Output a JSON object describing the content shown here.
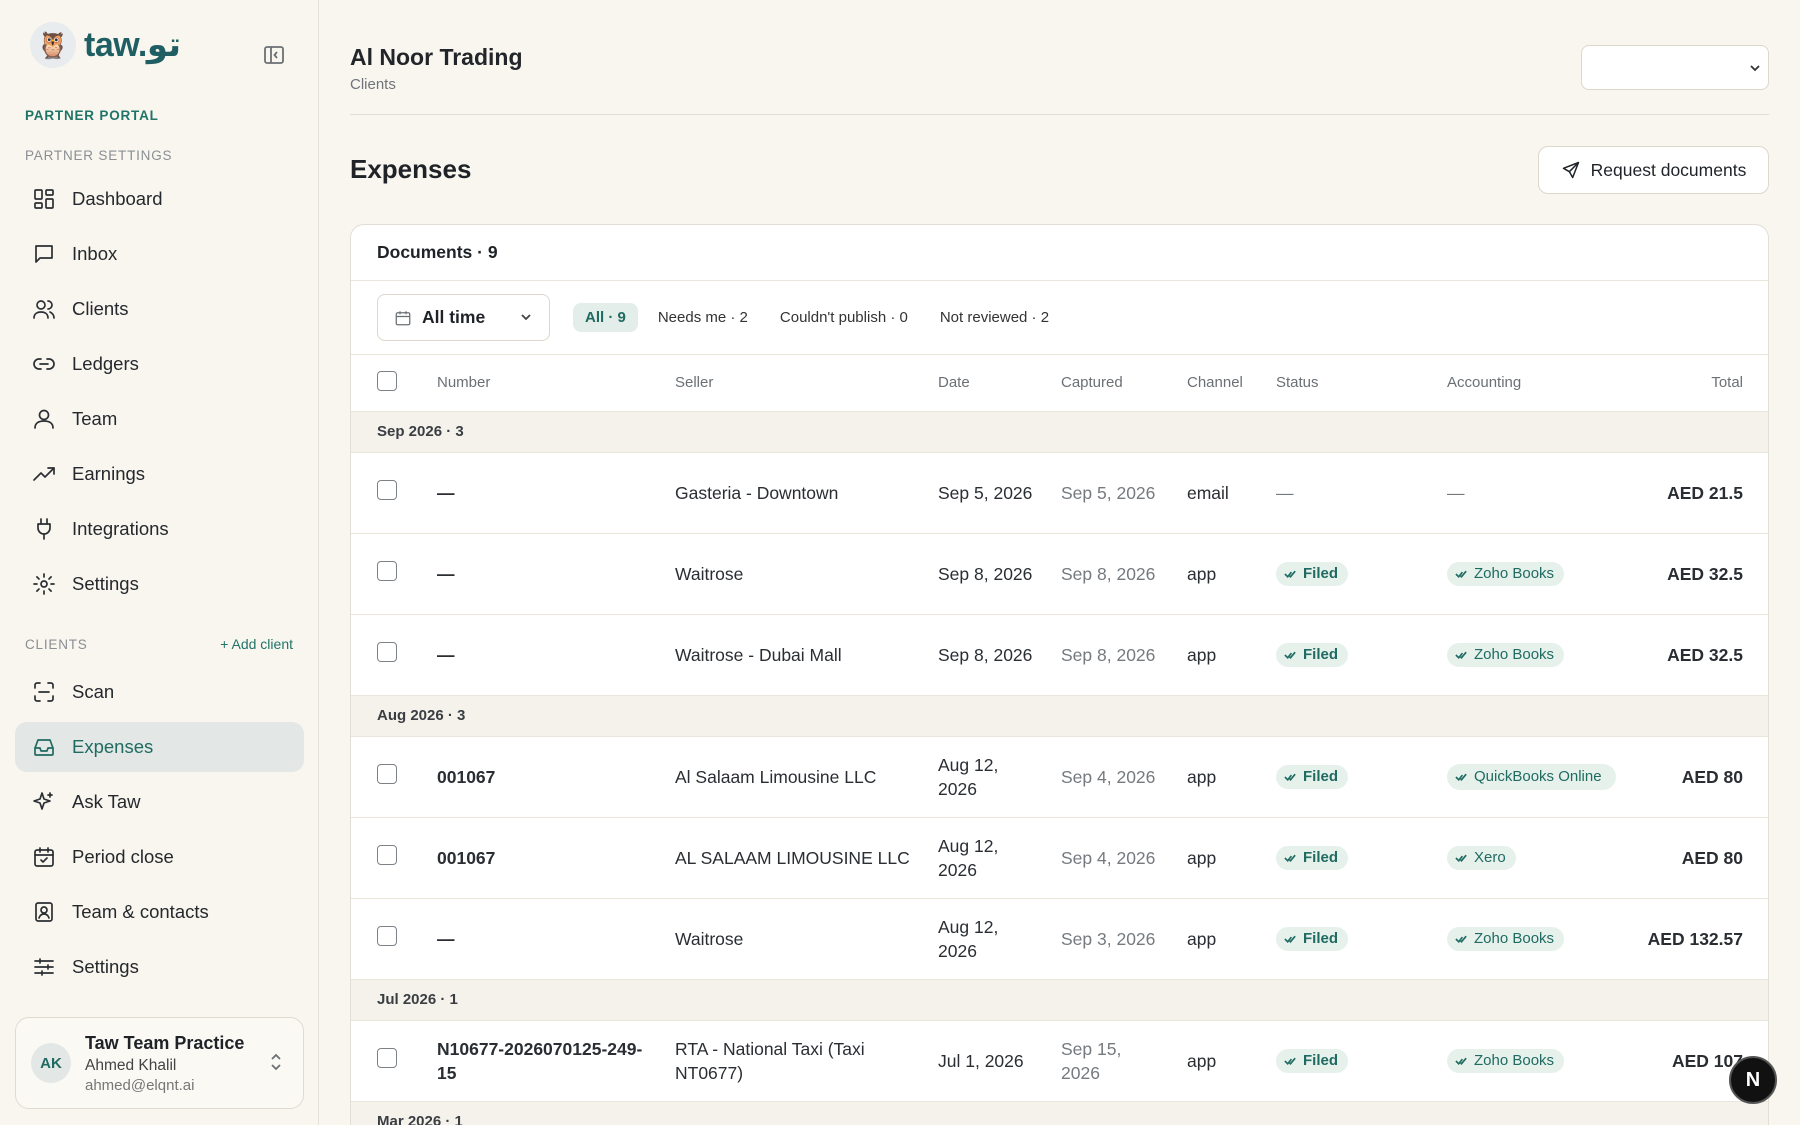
{
  "brand": {
    "name": "taw.",
    "arabic": "تو"
  },
  "sidebar": {
    "portal_label": "PARTNER PORTAL",
    "settings_label": "PARTNER SETTINGS",
    "partner_items": [
      {
        "label": "Dashboard",
        "icon": "dashboard-icon"
      },
      {
        "label": "Inbox",
        "icon": "chat-icon"
      },
      {
        "label": "Clients",
        "icon": "users-icon"
      },
      {
        "label": "Ledgers",
        "icon": "link-icon"
      },
      {
        "label": "Team",
        "icon": "user-icon"
      },
      {
        "label": "Earnings",
        "icon": "trend-icon"
      },
      {
        "label": "Integrations",
        "icon": "plug-icon"
      },
      {
        "label": "Settings",
        "icon": "gear-icon"
      }
    ],
    "clients_label": "CLIENTS",
    "add_client": "+ Add client",
    "client_items": [
      {
        "label": "Scan",
        "icon": "scan-icon"
      },
      {
        "label": "Expenses",
        "icon": "inbox-tray-icon",
        "active": true
      },
      {
        "label": "Ask Taw",
        "icon": "sparkle-icon"
      },
      {
        "label": "Period close",
        "icon": "calendar-check-icon"
      },
      {
        "label": "Team & contacts",
        "icon": "contact-icon"
      },
      {
        "label": "Settings",
        "icon": "sliders-icon"
      }
    ],
    "user": {
      "initials": "AK",
      "practice": "Taw Team Practice",
      "name": "Ahmed Khalil",
      "email": "ahmed@elqnt.ai"
    }
  },
  "header": {
    "title": "Al Noor Trading",
    "subtitle": "Clients"
  },
  "page": {
    "title": "Expenses",
    "request_button": "Request documents"
  },
  "documents": {
    "heading": "Documents · 9",
    "date_filter": "All time",
    "chips": [
      "All · 9",
      "Needs me · 2",
      "Couldn't publish · 0",
      "Not reviewed · 2"
    ],
    "columns": [
      "Number",
      "Seller",
      "Date",
      "Captured",
      "Channel",
      "Status",
      "Accounting",
      "Total"
    ],
    "groups": [
      {
        "label": "Sep 2026 · 3",
        "rows": [
          {
            "number": "—",
            "seller": "Gasteria - Downtown",
            "date": "Sep 5, 2026",
            "captured": "Sep 5, 2026",
            "channel": "email",
            "status": "—",
            "accounting": "—",
            "total": "AED 21.5"
          },
          {
            "number": "—",
            "seller": "Waitrose",
            "date": "Sep 8, 2026",
            "captured": "Sep 8, 2026",
            "channel": "app",
            "status": "Filed",
            "accounting": "Zoho Books",
            "total": "AED 32.5"
          },
          {
            "number": "—",
            "seller": "Waitrose - Dubai Mall",
            "date": "Sep 8, 2026",
            "captured": "Sep 8, 2026",
            "channel": "app",
            "status": "Filed",
            "accounting": "Zoho Books",
            "total": "AED 32.5"
          }
        ]
      },
      {
        "label": "Aug 2026 · 3",
        "rows": [
          {
            "number": "001067",
            "seller": "Al Salaam Limousine LLC",
            "date": "Aug 12, 2026",
            "captured": "Sep 4, 2026",
            "channel": "app",
            "status": "Filed",
            "accounting": "QuickBooks Online",
            "total": "AED 80"
          },
          {
            "number": "001067",
            "seller": "AL SALAAM LIMOUSINE LLC",
            "date": "Aug 12, 2026",
            "captured": "Sep 4, 2026",
            "channel": "app",
            "status": "Filed",
            "accounting": "Xero",
            "total": "AED 80"
          },
          {
            "number": "—",
            "seller": "Waitrose",
            "date": "Aug 12, 2026",
            "captured": "Sep 3, 2026",
            "channel": "app",
            "status": "Filed",
            "accounting": "Zoho Books",
            "total": "AED 132.57"
          }
        ]
      },
      {
        "label": "Jul 2026 · 1",
        "rows": [
          {
            "number": "N10677-2026070125-249-15",
            "seller": "RTA - National Taxi (Taxi NT0677)",
            "date": "Jul 1, 2026",
            "captured": "Sep 15, 2026",
            "channel": "app",
            "status": "Filed",
            "accounting": "Zoho Books",
            "total": "AED 107"
          }
        ]
      },
      {
        "label": "Mar 2026 · 1",
        "rows": []
      }
    ]
  },
  "fab_label": "N",
  "colors": {
    "accent": "#1f6b61",
    "badge_bg": "#e6f1ec",
    "background": "#f9f6ef"
  }
}
